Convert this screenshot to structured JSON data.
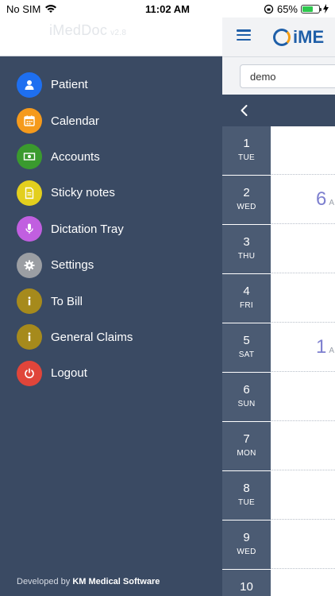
{
  "status_bar": {
    "carrier": "No SIM",
    "time": "11:02 AM",
    "battery_text": "65%",
    "battery_level": 0.65
  },
  "drawer": {
    "app_name": "iMedDoc",
    "version": "v2.8",
    "footer_prefix": "Developed by",
    "footer_company": "KM Medical Software",
    "items": [
      {
        "label": "Patient",
        "icon": "person-icon",
        "color": "#1e6ff0"
      },
      {
        "label": "Calendar",
        "icon": "calendar-icon",
        "color": "#f59a1c"
      },
      {
        "label": "Accounts",
        "icon": "money-icon",
        "color": "#3a9a2e"
      },
      {
        "label": "Sticky notes",
        "icon": "note-icon",
        "color": "#e3cf1e"
      },
      {
        "label": "Dictation Tray",
        "icon": "microphone-icon",
        "color": "#c15fe0"
      },
      {
        "label": "Settings",
        "icon": "gear-icon",
        "color": "#9b9ea3"
      },
      {
        "label": "To Bill",
        "icon": "info-icon",
        "color": "#a68a1c"
      },
      {
        "label": "General Claims",
        "icon": "info-icon",
        "color": "#a68a1c"
      },
      {
        "label": "Logout",
        "icon": "power-icon",
        "color": "#e0453a"
      }
    ]
  },
  "main": {
    "logo_text": "iME",
    "search_value": "demo",
    "days": [
      {
        "num": "1",
        "name": "TUE",
        "count": ""
      },
      {
        "num": "2",
        "name": "WED",
        "count": "6",
        "suffix": "A"
      },
      {
        "num": "3",
        "name": "THU",
        "count": ""
      },
      {
        "num": "4",
        "name": "FRI",
        "count": ""
      },
      {
        "num": "5",
        "name": "SAT",
        "count": "1",
        "suffix": "A"
      },
      {
        "num": "6",
        "name": "SUN",
        "count": ""
      },
      {
        "num": "7",
        "name": "MON",
        "count": ""
      },
      {
        "num": "8",
        "name": "TUE",
        "count": ""
      },
      {
        "num": "9",
        "name": "WED",
        "count": ""
      },
      {
        "num": "10",
        "name": "",
        "count": ""
      }
    ]
  }
}
